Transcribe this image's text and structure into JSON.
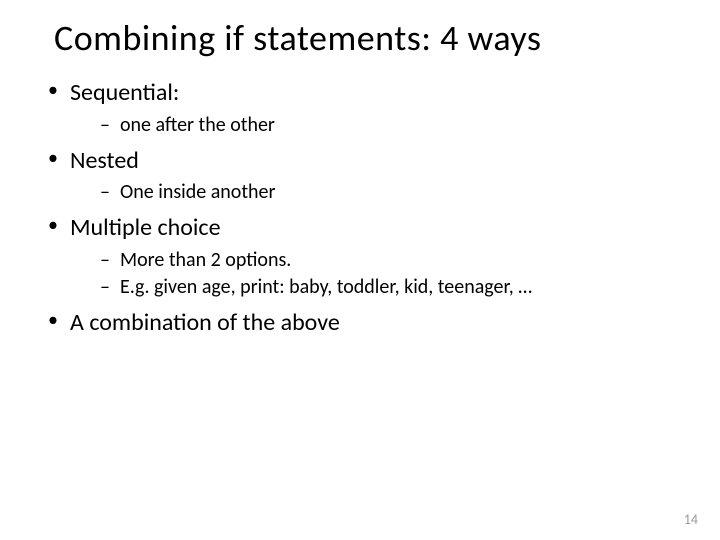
{
  "title": "Combining if statements:  4 ways",
  "bullets": {
    "b0": {
      "label": "Sequential:",
      "sub": {
        "s0": "one after the other"
      }
    },
    "b1": {
      "label": "Nested",
      "sub": {
        "s0": "One inside another"
      }
    },
    "b2": {
      "label": "Multiple choice",
      "sub": {
        "s0": "More than 2 options.",
        "s1": "E.g. given age, print: baby, toddler, kid, teenager, …"
      }
    },
    "b3": {
      "label": "A combination of the above"
    }
  },
  "page_number": "14"
}
